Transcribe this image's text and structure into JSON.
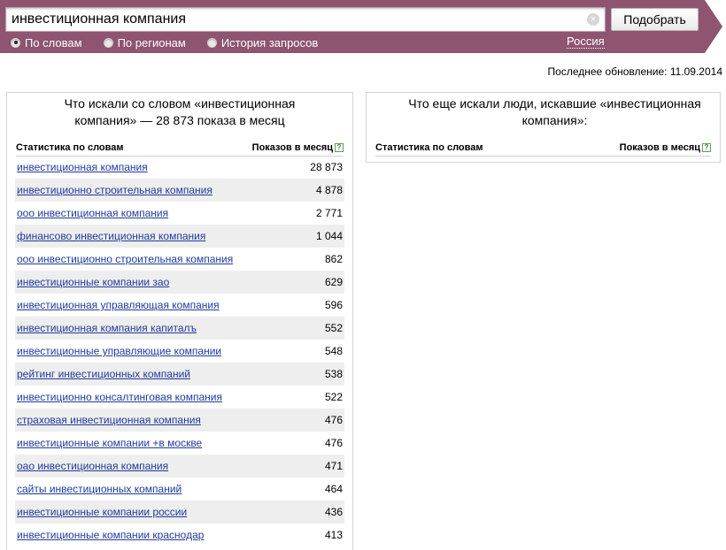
{
  "search": {
    "value": "инвестиционная компания",
    "button_label": "Подобрать"
  },
  "modes": [
    {
      "label": "По словам",
      "selected": true
    },
    {
      "label": "По регионам",
      "selected": false
    },
    {
      "label": "История запросов",
      "selected": false
    }
  ],
  "region": "Россия",
  "last_update": "Последнее обновление: 11.09.2014",
  "left_panel": {
    "title": "Что искали со словом «инвестиционная компания» — 28 873 показа в месяц",
    "col_keyword": "Статистика по словам",
    "col_shows": "Показов в месяц",
    "rows": [
      {
        "phrase": "инвестиционная компания",
        "count": "28 873"
      },
      {
        "phrase": "инвестиционно строительная компания",
        "count": "4 878"
      },
      {
        "phrase": "ооо инвестиционная компания",
        "count": "2 771"
      },
      {
        "phrase": "финансово инвестиционная компания",
        "count": "1 044"
      },
      {
        "phrase": "ооо инвестиционно строительная компания",
        "count": "862"
      },
      {
        "phrase": "инвестиционные компании зао",
        "count": "629"
      },
      {
        "phrase": "инвестиционная управляющая компания",
        "count": "596"
      },
      {
        "phrase": "инвестиционная компания капиталъ",
        "count": "552"
      },
      {
        "phrase": "инвестиционные управляющие компании",
        "count": "548"
      },
      {
        "phrase": "рейтинг инвестиционных компаний",
        "count": "538"
      },
      {
        "phrase": "инвестиционно консалтинговая компания",
        "count": "522"
      },
      {
        "phrase": "страховая инвестиционная компания",
        "count": "476"
      },
      {
        "phrase": "инвестиционные компании +в москве",
        "count": "476"
      },
      {
        "phrase": "оао инвестиционная компания",
        "count": "471"
      },
      {
        "phrase": "сайты инвестиционных компаний",
        "count": "464"
      },
      {
        "phrase": "инвестиционные компании россии",
        "count": "436"
      },
      {
        "phrase": "инвестиционные компании краснодар",
        "count": "413"
      }
    ]
  },
  "right_panel": {
    "title": "Что еще искали люди, искавшие «инвестиционная компания»:",
    "col_keyword": "Статистика по словам",
    "col_shows": "Показов в месяц"
  },
  "colors": {
    "band": "#8e5470",
    "link": "#1f3b9b",
    "row_alt": "#eeeeee"
  },
  "help_glyph": "?"
}
